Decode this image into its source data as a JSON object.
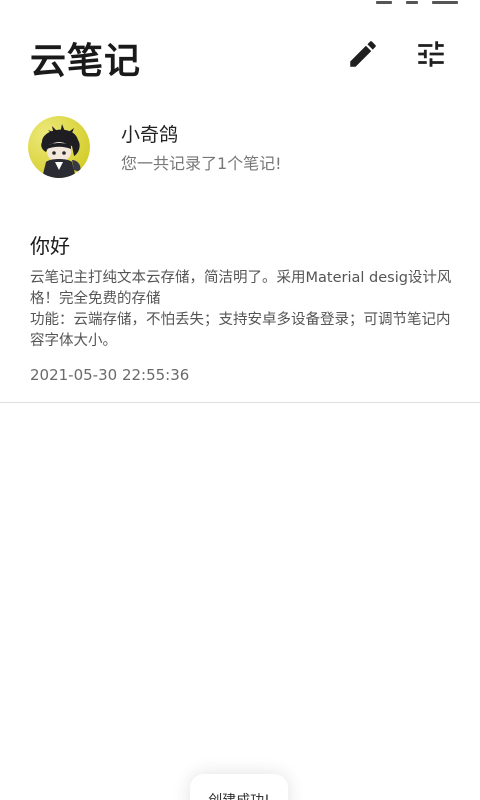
{
  "app": {
    "title": "云笔记",
    "edit_icon": "pencil-icon",
    "tune_icon": "tune-sliders-icon"
  },
  "profile": {
    "name": "小奇鸽",
    "summary": "您一共记录了1个笔记!"
  },
  "notes": [
    {
      "title": "你好",
      "body": "云笔记主打纯文本云存储，简洁明了。采用Material desig设计风格！完全免费的存储\n功能：云端存储，不怕丢失；支持安卓多设备登录；可调节笔记内容字体大小。",
      "time": "2021-05-30 22:55:36"
    }
  ],
  "toast": {
    "message": "创建成功!"
  },
  "colors": {
    "background": "#ffffff",
    "title_text": "#1a1a1a",
    "secondary_text": "#777777",
    "divider": "#dedede",
    "avatar_bg": "#e8e23a"
  }
}
